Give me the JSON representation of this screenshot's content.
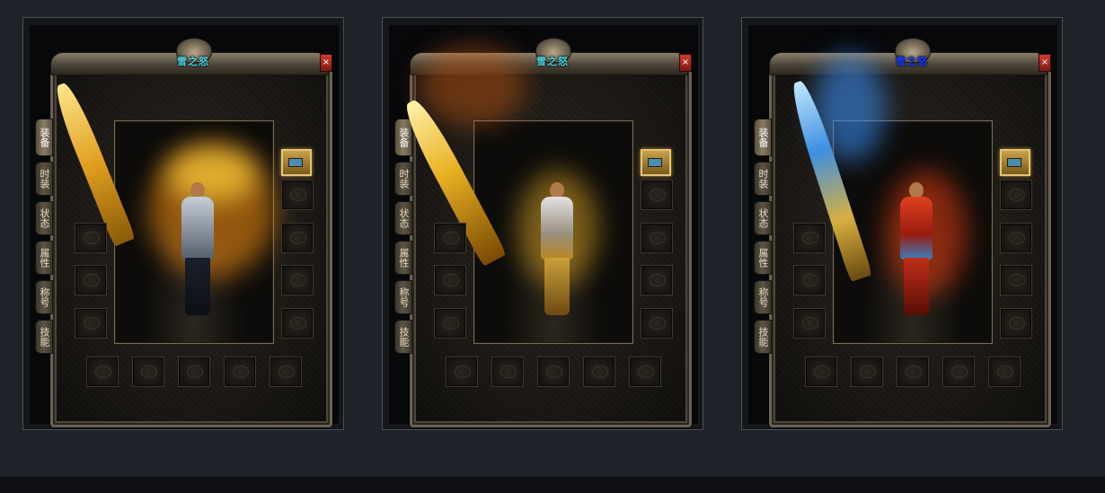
{
  "panels": [
    {
      "title": "雪之怒",
      "title_color": "#46d6e6",
      "close_label": "×",
      "tabs": [
        "装备",
        "时装",
        "状态",
        "属性",
        "称号",
        "技能"
      ],
      "active_tab": "装备",
      "theme": "golden-wing",
      "bag_icon": "chest-icon"
    },
    {
      "title": "雪之怒",
      "title_color": "#46d6e6",
      "close_label": "×",
      "tabs": [
        "装备",
        "时装",
        "状态",
        "属性",
        "称号",
        "技能"
      ],
      "active_tab": "装备",
      "theme": "golden-blade",
      "bag_icon": "chest-icon"
    },
    {
      "title": "雪之怒",
      "title_color": "#1a3cff",
      "close_label": "×",
      "tabs": [
        "装备",
        "时装",
        "状态",
        "属性",
        "称号",
        "技能"
      ],
      "active_tab": "装备",
      "theme": "ice-fire",
      "bag_icon": "chest-icon"
    }
  ],
  "slots": {
    "left": [
      "helmet-slot",
      "necklace-slot",
      "bracelet-slot"
    ],
    "right": [
      "amulet-slot",
      "medal-slot",
      "ring-slot",
      "bracelet-slot-right"
    ],
    "bottom": [
      "belt-slot",
      "boots-slot",
      "gem-slot",
      "mount-slot",
      "talisman-slot"
    ]
  }
}
